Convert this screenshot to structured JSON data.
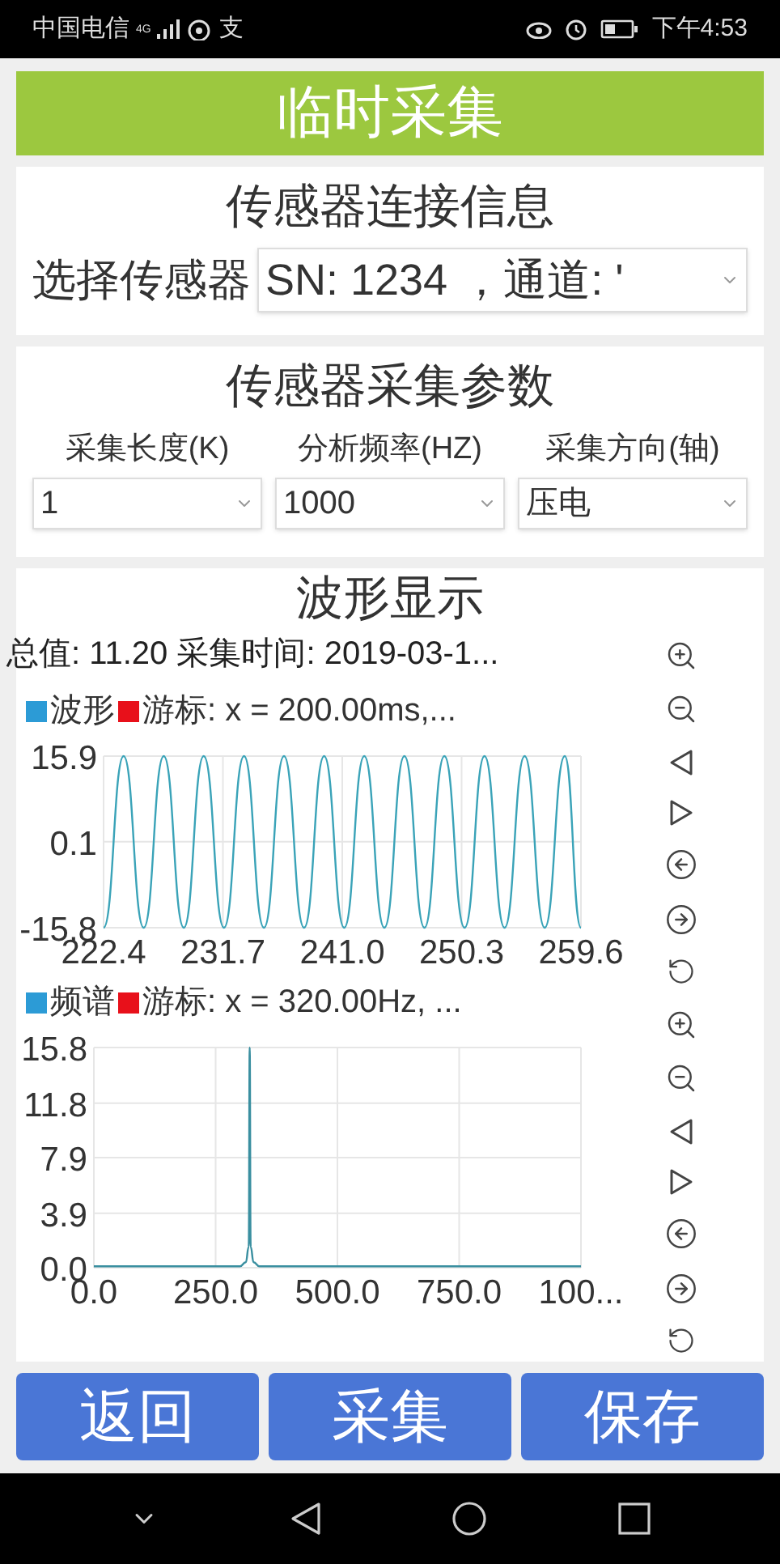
{
  "status_bar": {
    "carrier": "中国电信",
    "network": "4G",
    "app_badge": "支",
    "time": "下午4:53"
  },
  "header": {
    "title": "临时采集"
  },
  "connection": {
    "title": "传感器连接信息",
    "label": "选择传感器",
    "select": {
      "value": "SN: 1234 ，通道: '"
    }
  },
  "params": {
    "title": "传感器采集参数",
    "fields": [
      {
        "label": "采集长度(K)",
        "value": "1"
      },
      {
        "label": "分析频率(HZ)",
        "value": "1000"
      },
      {
        "label": "采集方向(轴)",
        "value": "压电"
      }
    ]
  },
  "waveform": {
    "title": "波形显示",
    "summary": "总值: 11.20 采集时间: 2019-03-1...",
    "charts": [
      {
        "legend": [
          {
            "label": "波形",
            "color": "#2c9bd6"
          },
          {
            "label": "游标: x = 200.00ms,...",
            "color": "#e8101a"
          }
        ],
        "chart_data": {
          "type": "line",
          "x": [
            222.4,
            223.96,
            225.53,
            227.09,
            228.65,
            230.21,
            231.78,
            233.34,
            234.9,
            236.46,
            238.03,
            239.59,
            241.15,
            242.71,
            244.28,
            245.84,
            247.4,
            248.96,
            250.53,
            252.09,
            253.65,
            255.21,
            256.78,
            258.34,
            259.6
          ],
          "series": [
            {
              "color": "#3aa3b8",
              "values": [
                -15.8,
                15.9,
                -15.8,
                15.9,
                -15.8,
                15.9,
                -15.8,
                15.9,
                -15.8,
                15.9,
                -15.8,
                15.9,
                -15.8,
                15.9,
                -15.8,
                15.9,
                -15.8,
                15.9,
                -15.8,
                15.9,
                -15.8,
                15.9,
                -15.8,
                15.9,
                -15.8
              ]
            }
          ],
          "xlim": [
            222.4,
            259.6
          ],
          "ylim": [
            -15.8,
            15.9
          ],
          "xticks": [
            222.4,
            231.7,
            {
              "value": 241,
              "label": "241.0"
            },
            250.3,
            259.6
          ],
          "yticks": [
            -15.8,
            0.1,
            15.9
          ],
          "grid": true
        }
      },
      {
        "legend": [
          {
            "label": "频谱",
            "color": "#2c9bd6"
          },
          {
            "label": "游标: x = 320.00Hz, ...",
            "color": "#e8101a"
          }
        ],
        "chart_data": {
          "type": "line",
          "x": [
            0,
            300,
            312,
            318,
            320,
            322,
            328,
            340,
            1000
          ],
          "series": [
            {
              "color": "#3a8fa0",
              "values": [
                0.1,
                0.1,
                0.4,
                1.5,
                15.8,
                1.5,
                0.4,
                0.1,
                0.1
              ]
            }
          ],
          "xlim": [
            0,
            1000
          ],
          "ylim": [
            0,
            15.8
          ],
          "xticks": [
            {
              "value": 0,
              "label": "0.0"
            },
            {
              "value": 250,
              "label": "250.0"
            },
            {
              "value": 500,
              "label": "500.0"
            },
            {
              "value": 750,
              "label": "750.0"
            },
            {
              "value": 1000,
              "label": "100..."
            }
          ],
          "yticks": [
            {
              "value": 0,
              "label": "0.0"
            },
            3.9,
            7.9,
            11.8,
            15.8
          ],
          "grid": true
        }
      }
    ]
  },
  "buttons": [
    "返回",
    "采集",
    "保存"
  ]
}
